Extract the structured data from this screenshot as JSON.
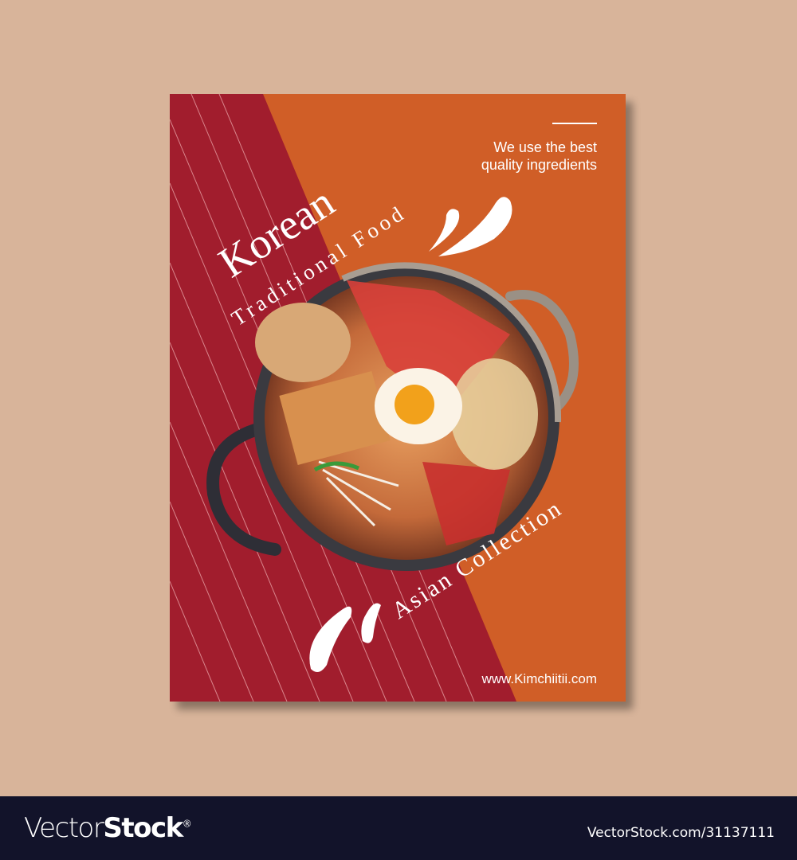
{
  "poster": {
    "tagline_line1": "We use the best",
    "tagline_line2": "quality ingredients",
    "title": "Korean",
    "subtitle": "Traditional Food",
    "collection": "Asian Collection",
    "website": "www.Kimchiitii.com",
    "colors": {
      "background": "#d8b49a",
      "red": "#a11d2d",
      "orange": "#d05e27",
      "text": "#ffffff"
    }
  },
  "footer": {
    "brand_light": "Vector",
    "brand_bold": "Stock",
    "registered": "®",
    "image_ref": "VectorStock.com/31137111"
  }
}
